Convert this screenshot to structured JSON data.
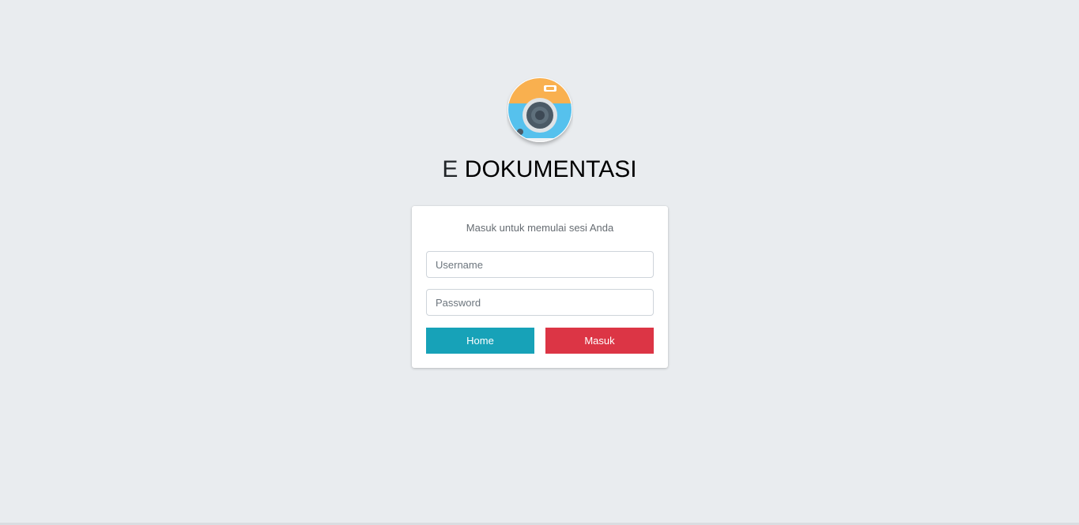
{
  "brand": {
    "prefix": "E",
    "name": "DOKUMENTASI"
  },
  "logo": {
    "icon": "camera-icon",
    "colors": {
      "top": "#f9b050",
      "body": "#56c1ed",
      "lens": "#4b5a66",
      "ring": "#dfe3e6"
    }
  },
  "login": {
    "message": "Masuk untuk memulai sesi Anda",
    "username_placeholder": "Username",
    "password_placeholder": "Password",
    "home_label": "Home",
    "submit_label": "Masuk"
  },
  "colors": {
    "background": "#e9ecef",
    "home_button": "#17a2b8",
    "submit_button": "#dc3545"
  }
}
